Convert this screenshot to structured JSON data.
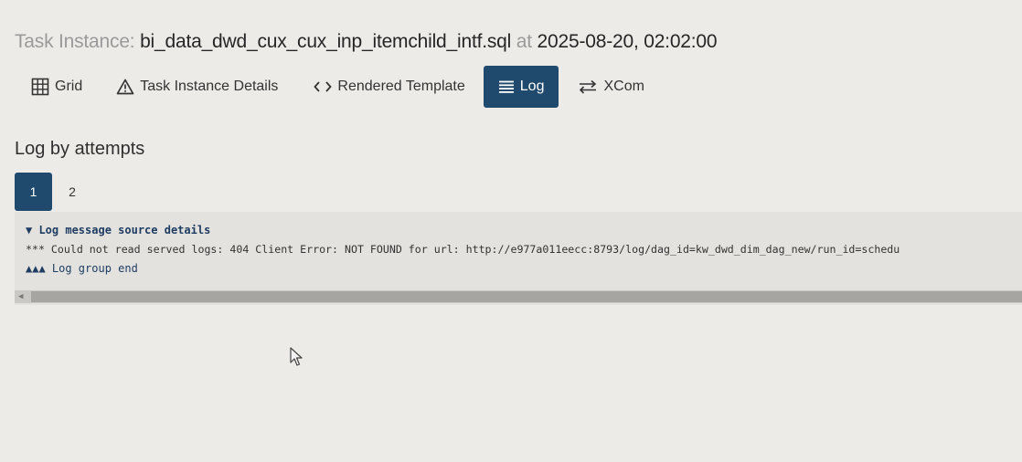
{
  "header": {
    "label": "Task Instance:",
    "task_name": "bi_data_dwd_cux_cux_inp_itemchild_intf.sql",
    "at_word": "at",
    "datetime": "2025-08-20, 02:02:00"
  },
  "tabs": [
    {
      "label": "Grid",
      "icon": "grid-icon",
      "active": false
    },
    {
      "label": "Task Instance Details",
      "icon": "warning-triangle-icon",
      "active": false
    },
    {
      "label": "Rendered Template",
      "icon": "code-brackets-icon",
      "active": false
    },
    {
      "label": "Log",
      "icon": "list-lines-icon",
      "active": true
    },
    {
      "label": "XCom",
      "icon": "swap-arrows-icon",
      "active": false
    }
  ],
  "section": {
    "title": "Log by attempts"
  },
  "attempts": [
    "1",
    "2"
  ],
  "selected_attempt": "1",
  "log": {
    "lines": [
      "▼ Log message source details",
      "*** Could not read served logs: 404 Client Error: NOT FOUND for url: http://e977a011eecc:8793/log/dag_id=kw_dwd_dim_dag_new/run_id=schedu",
      "▲▲▲ Log group end"
    ]
  },
  "colors": {
    "accent": "#1f4a6e",
    "background": "#ecebe7",
    "log_background": "#e3e2de"
  }
}
